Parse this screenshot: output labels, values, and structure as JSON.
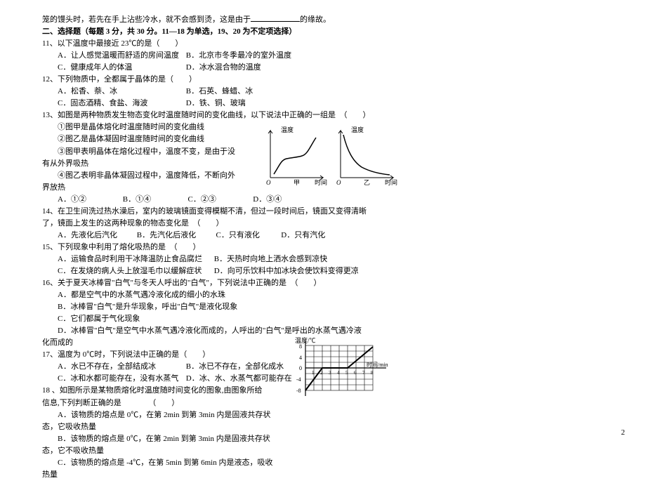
{
  "intro_tail": "笼的馒头时，若先在手上沾些冷水，就不会感到烫，这是由于",
  "intro_tail_end": "的缘故。",
  "section2": "二、选择题（每题 3 分，共 30 分。11—18 为单选，19、20 为不定项选择）",
  "q11": {
    "stem": "11、以下温度中最接近 23℃的是（　　）",
    "A": "A．让人感觉温暖而舒适的房间温度",
    "B": "B．北京市冬季最冷的室外温度",
    "C": "C．健康成年人的体温",
    "D": "D．冰水混合物的温度"
  },
  "q12": {
    "stem": "12、下列物质中，全都属于晶体的是（　　）",
    "A": "A．松香、萘、冰",
    "B": "B．石英、蜂蜡、冰",
    "C": "C．固态酒精、食盐、海波",
    "D": "D．铁、铜、玻璃"
  },
  "q13": {
    "stem_a": "13、如图是两种物质发生物态变化时温度随时间的变化曲线，以下说法中正确的一组是　（　　）",
    "c1": "①图甲是晶体熔化时温度随时间的变化曲线",
    "c2": "②图乙是晶体凝固时温度随时间的变化曲线",
    "c3a": "③图甲表明晶体在熔化过程中，温度不变，是由于没",
    "c3b": "有从外界吸热",
    "c4a": "④图乙表明非晶体凝固过程中，温度降低，不断向外",
    "c4b": "界放热",
    "A": "A．①②",
    "B": "B．①④",
    "C": "C．②③",
    "D": "D．③④",
    "axis1": "温度",
    "axis2": "温度",
    "tlabel": "时间",
    "cap1": "甲",
    "cap2": "乙"
  },
  "q14": {
    "l1": "14、在卫生间洗过热水澡后，室内的玻璃镜面变得模糊不清，但过一段时间后，镜面又变得清晰",
    "l2": "了，镜面上发生的这两种现象的物态变化是　（　　）",
    "A": "A．先液化后汽化",
    "B": "B．先汽化后液化",
    "C": "C．只有液化",
    "D": "D．只有汽化"
  },
  "q15": {
    "stem": "15、下列现象中利用了熔化吸热的是　（　　）",
    "A": "A．运输食品时利用干冰降温防止食品腐烂",
    "B": "B．天热时向地上洒水会感到凉快",
    "C": "C．在发烧的病人头上放湿毛巾以缓解症状",
    "D": "D．向可乐饮料中加冰块会使饮料变得更凉"
  },
  "q16": {
    "stem": "16、关于夏天冰棒冒\"白气\"与冬天人呼出的\"白气\"，下列说法中正确的是　（　　）",
    "A": "A．都是空气中的水蒸气遇冷液化成的细小的水珠",
    "B": "B．冰棒冒\"白气\"是升华现象，呼出\"白气\"是液化现象",
    "C": "C．它们都属于气化现象",
    "Da": "D．冰棒冒\"白气\"是空气中水蒸气遇冷液化而成的，人呼出的\"白气\"是呼出的水蒸气遇冷液",
    "Db": "化而成的"
  },
  "q17": {
    "stem": "17、温度为 0℃时，下列说法中正确的是（　　）",
    "A": "A．水已不存在，全部结成冰",
    "B": "B．冰已不存在，全部化成水",
    "C": "C．冰和水都可能存在，没有水蒸气",
    "D": "D．冰、水、水蒸气都可能存在"
  },
  "q18": {
    "l1": "18 、如图所示是某物质熔化时温度随时间变化的图象,由图象所给",
    "l2": "信息,下列判断正确的是　　　　（　　）",
    "Aa": "A．该物质的熔点是 0℃，在第 2min 到第 3min 内是固液共存状",
    "Ab": "态，它吸收热量",
    "Ba": "B．该物质的熔点是 0℃，在第 2min 到第 3min 内是固液共存状",
    "Bb": "态，它不吸收热量",
    "Ca": "C．该物质的熔点是 -4℃，在第 5min 到第 6min 内是液态，吸收",
    "Cb": "热量",
    "ylab": "温度/℃",
    "xlab": "时间/min"
  },
  "page_number": "2"
}
